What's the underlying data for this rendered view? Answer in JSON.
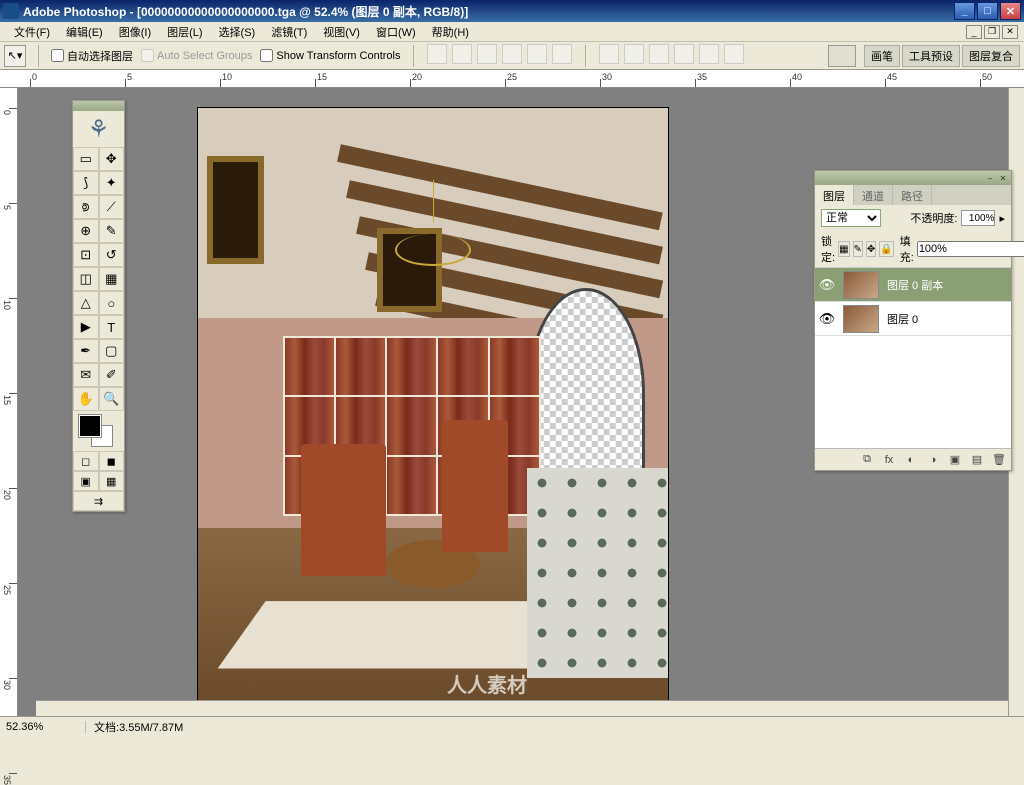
{
  "window": {
    "title": "Adobe Photoshop - [00000000000000000000.tga @ 52.4% (图层 0 副本, RGB/8)]"
  },
  "menu": {
    "file": "文件(F)",
    "edit": "编辑(E)",
    "image": "图像(I)",
    "layer": "图层(L)",
    "select": "选择(S)",
    "filter": "滤镜(T)",
    "view": "视图(V)",
    "window": "窗口(W)",
    "help": "帮助(H)"
  },
  "options": {
    "auto_select_layer": "自动选择图层",
    "auto_select_groups": "Auto Select Groups",
    "show_transform": "Show Transform Controls"
  },
  "palette_well": {
    "brushes": "画笔",
    "tool_presets": "工具预设",
    "layer_comps": "图层复合"
  },
  "layers_panel": {
    "tab_layers": "图层",
    "tab_channels": "通道",
    "tab_paths": "路径",
    "blend_mode": "正常",
    "opacity_label": "不透明度:",
    "opacity_value": "100%",
    "lock_label": "锁定:",
    "fill_label": "填充:",
    "fill_value": "100%",
    "layers": [
      {
        "name": "图层 0 副本",
        "selected": true
      },
      {
        "name": "图层 0",
        "selected": false
      }
    ]
  },
  "status": {
    "zoom": "52.36%",
    "doc_label": "文档:",
    "doc_size": "3.55M/7.87M"
  },
  "watermark": "人人素材",
  "ruler_ticks": [
    "0",
    "5",
    "10",
    "15",
    "20",
    "25",
    "30",
    "35",
    "40",
    "45",
    "50"
  ]
}
